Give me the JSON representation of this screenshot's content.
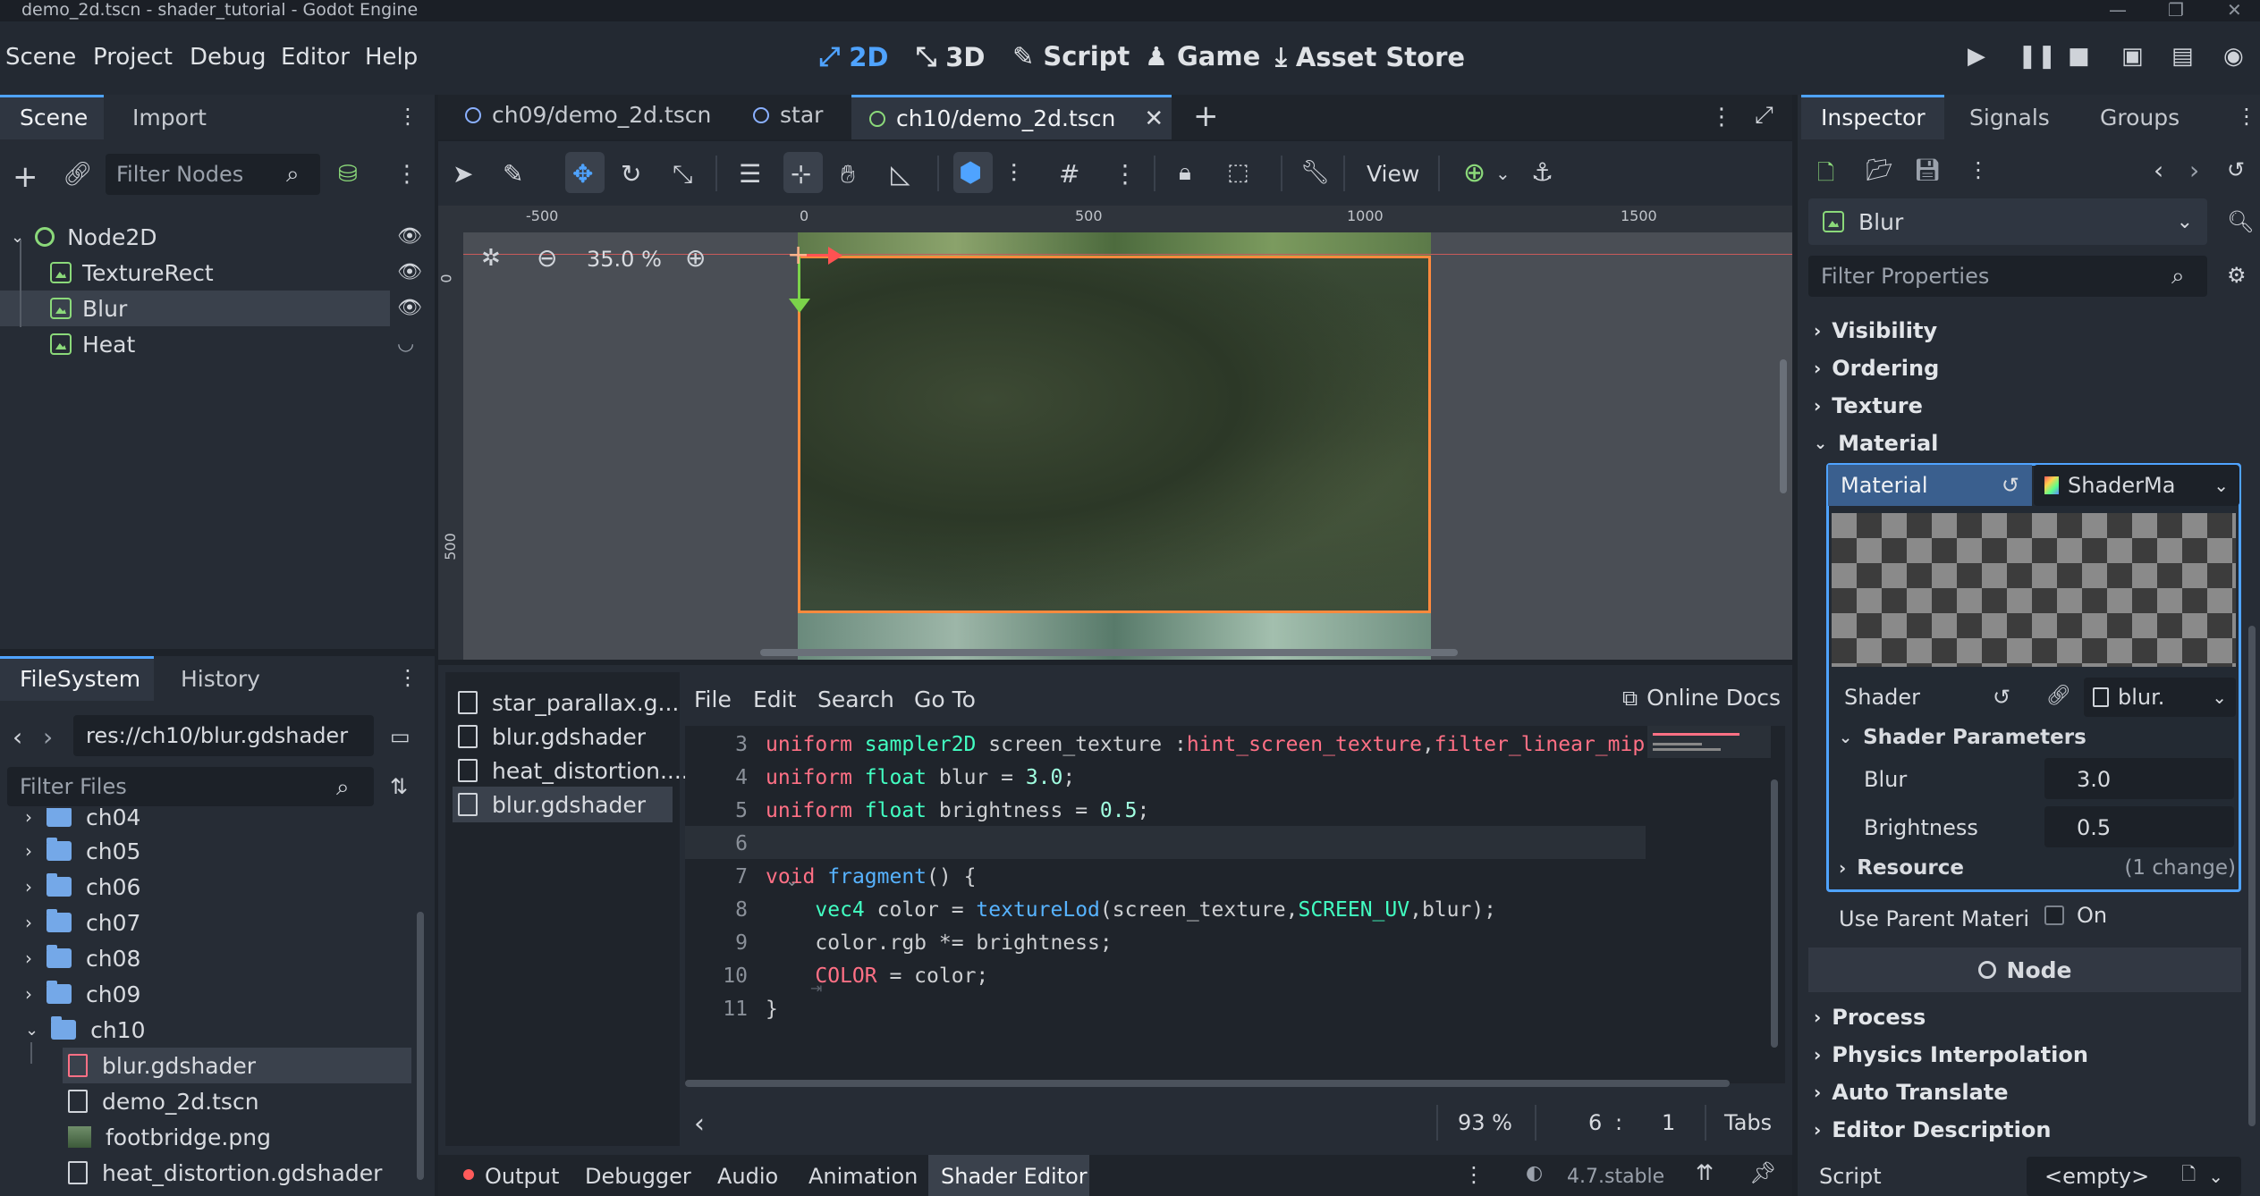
{
  "window": {
    "title": "demo_2d.tscn - shader_tutorial - Godot Engine"
  },
  "menu": [
    "Scene",
    "Project",
    "Debug",
    "Editor",
    "Help"
  ],
  "workspaces": [
    {
      "label": "2D",
      "icon": "2d-icon",
      "active": true
    },
    {
      "label": "3D",
      "icon": "3d-icon",
      "active": false
    },
    {
      "label": "Script",
      "icon": "script-icon",
      "active": false
    },
    {
      "label": "Game",
      "icon": "game-icon",
      "active": false
    },
    {
      "label": "Asset Store",
      "icon": "asset-store-icon",
      "active": false
    }
  ],
  "scene_dock": {
    "tabs": [
      "Scene",
      "Import"
    ],
    "filter_placeholder": "Filter Nodes",
    "nodes": [
      {
        "name": "Node2D",
        "depth": 0,
        "visible_icon": "eye-icon"
      },
      {
        "name": "TextureRect",
        "depth": 1,
        "visible_icon": "eye-icon"
      },
      {
        "name": "Blur",
        "depth": 1,
        "visible_icon": "eye-icon",
        "selected": true
      },
      {
        "name": "Heat",
        "depth": 1,
        "visible_icon": "eye-closed-icon"
      }
    ]
  },
  "filesystem": {
    "tabs": [
      "FileSystem",
      "History"
    ],
    "path": "res://ch10/blur.gdshader",
    "filter_placeholder": "Filter Files",
    "items": [
      {
        "name": "ch04",
        "type": "folder",
        "depth": 0
      },
      {
        "name": "ch05",
        "type": "folder",
        "depth": 0
      },
      {
        "name": "ch06",
        "type": "folder",
        "depth": 0
      },
      {
        "name": "ch07",
        "type": "folder",
        "depth": 0
      },
      {
        "name": "ch08",
        "type": "folder",
        "depth": 0
      },
      {
        "name": "ch09",
        "type": "folder",
        "depth": 0
      },
      {
        "name": "ch10",
        "type": "folder",
        "depth": 0,
        "open": true
      },
      {
        "name": "blur.gdshader",
        "type": "shader",
        "depth": 1,
        "selected": true
      },
      {
        "name": "demo_2d.tscn",
        "type": "scene",
        "depth": 1
      },
      {
        "name": "footbridge.png",
        "type": "image",
        "depth": 1
      },
      {
        "name": "heat_distortion.gdshader",
        "type": "shader",
        "depth": 1
      }
    ]
  },
  "editor_tabs": [
    {
      "label": "ch09/demo_2d.tscn",
      "active": false
    },
    {
      "label": "star",
      "active": false
    },
    {
      "label": "ch10/demo_2d.tscn",
      "active": true
    }
  ],
  "toolbar": {
    "view_label": "View"
  },
  "viewport": {
    "zoom": "35.0 %",
    "ruler_h": [
      "-500",
      "0",
      "500",
      "1000",
      "1500"
    ],
    "ruler_v": [
      "0",
      "500"
    ]
  },
  "shader_files": [
    "star_parallax.g...",
    "blur.gdshader",
    "heat_distortion....",
    "blur.gdshader"
  ],
  "shader_menu": [
    "File",
    "Edit",
    "Search",
    "Go To"
  ],
  "online_docs": "Online Docs",
  "code": [
    {
      "n": "3",
      "tokens": [
        [
          "kw",
          "uniform "
        ],
        [
          "ty",
          "sampler2D "
        ],
        [
          "plain",
          "screen_texture :"
        ],
        [
          "hint",
          "hint_screen_texture"
        ],
        [
          "plain",
          ","
        ],
        [
          "hint",
          "filter_linear_mip"
        ]
      ]
    },
    {
      "n": "4",
      "tokens": [
        [
          "kw",
          "uniform "
        ],
        [
          "ty",
          "float "
        ],
        [
          "plain",
          "blur = "
        ],
        [
          "num",
          "3.0"
        ],
        [
          "plain",
          ";"
        ]
      ]
    },
    {
      "n": "5",
      "tokens": [
        [
          "kw",
          "uniform "
        ],
        [
          "ty",
          "float "
        ],
        [
          "plain",
          "brightness = "
        ],
        [
          "num",
          "0.5"
        ],
        [
          "plain",
          ";"
        ]
      ]
    },
    {
      "n": "6",
      "tokens": []
    },
    {
      "n": "7",
      "tokens": [
        [
          "kw",
          "void "
        ],
        [
          "fn",
          "fragment"
        ],
        [
          "plain",
          "() {"
        ]
      ]
    },
    {
      "n": "8",
      "tokens": [
        [
          "plain",
          "    "
        ],
        [
          "ty",
          "vec4 "
        ],
        [
          "plain",
          "color = "
        ],
        [
          "fn",
          "textureLod"
        ],
        [
          "plain",
          "(screen_texture,"
        ],
        [
          "ty",
          "SCREEN_UV"
        ],
        [
          "plain",
          ",blur);"
        ]
      ]
    },
    {
      "n": "9",
      "tokens": [
        [
          "plain",
          "    color.rgb *= brightness;"
        ]
      ]
    },
    {
      "n": "10",
      "tokens": [
        [
          "plain",
          "    "
        ],
        [
          "kw",
          "COLOR"
        ],
        [
          "plain",
          " = color;"
        ]
      ]
    },
    {
      "n": "11",
      "tokens": [
        [
          "plain",
          "}"
        ]
      ]
    }
  ],
  "status": {
    "zoom": "93 %",
    "line": "6",
    "col": "1",
    "indent": "Tabs"
  },
  "bottom_tabs": [
    "Output",
    "Debugger",
    "Audio",
    "Animation",
    "Shader Editor"
  ],
  "version": "4.7.stable",
  "inspector": {
    "tabs": [
      "Inspector",
      "Signals",
      "Groups"
    ],
    "object": "Blur",
    "filter_placeholder": "Filter Properties",
    "sections": [
      "Visibility",
      "Ordering",
      "Texture",
      "Material"
    ],
    "material_label": "Material",
    "material_value": "ShaderMa",
    "shader_label": "Shader",
    "shader_value": "blur.",
    "shader_params_label": "Shader Parameters",
    "params": [
      {
        "label": "Blur",
        "value": "3.0"
      },
      {
        "label": "Brightness",
        "value": "0.5"
      }
    ],
    "resource_label": "Resource",
    "resource_note": "(1 change)",
    "use_parent_label": "Use Parent Materi",
    "use_parent_value": "On",
    "node_header": "Node",
    "node_sections": [
      "Process",
      "Physics Interpolation",
      "Auto Translate",
      "Editor Description"
    ],
    "script_label": "Script",
    "script_value": "<empty>"
  },
  "colors": {
    "accent": "#4fa3ff",
    "selection_border": "#ff8a3d",
    "node_green": "#8bd97a"
  }
}
